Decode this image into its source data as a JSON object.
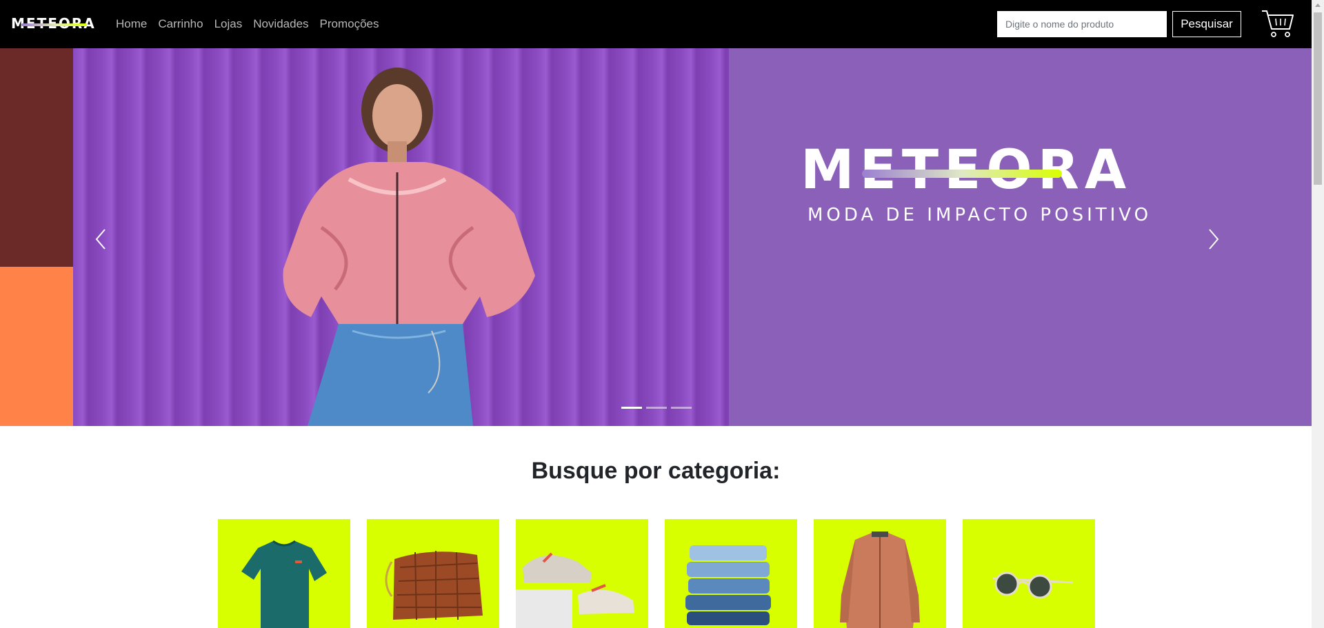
{
  "navbar": {
    "brand": "METEORA",
    "links": [
      "Home",
      "Carrinho",
      "Lojas",
      "Novidades",
      "Promoções"
    ],
    "search_placeholder": "Digite o nome do produto",
    "search_button": "Pesquisar"
  },
  "carousel": {
    "brand": "METEORA",
    "tagline": "MODA DE IMPACTO POSITIVO",
    "slide_count": 3,
    "active_slide": 1
  },
  "categories": {
    "title": "Busque por categoria:",
    "items": [
      "t-shirt",
      "bag",
      "sneakers",
      "jeans",
      "jacket",
      "sunglasses"
    ]
  },
  "colors": {
    "navbar": "#000000",
    "banner_purple": "#8a60b8",
    "accent_lime": "#d8ff00",
    "side_dark_red": "#6b2a28",
    "side_orange": "#ff8248"
  }
}
